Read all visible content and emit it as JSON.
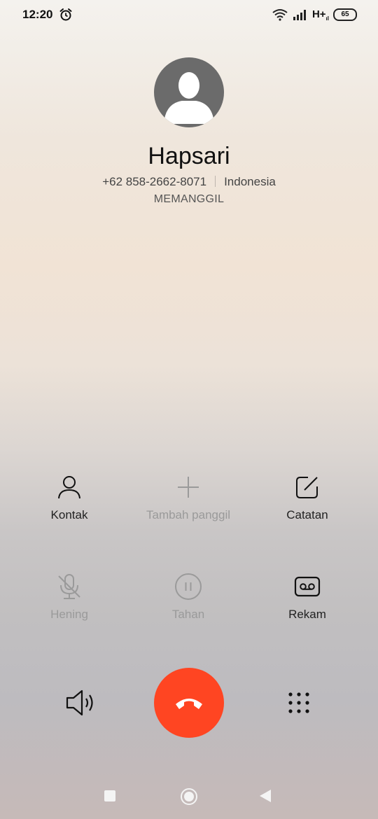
{
  "status_bar": {
    "time": "12:20",
    "network_type": "H+",
    "network_sub": "ıl",
    "battery": "65",
    "icons": [
      "alarm-icon",
      "wifi-icon",
      "signal-icon",
      "battery-icon"
    ]
  },
  "contact": {
    "name": "Hapsari",
    "number": "+62 858-2662-8071",
    "region": "Indonesia",
    "state": "MEMANGGIL"
  },
  "controls": {
    "contacts": "Kontak",
    "add_call": "Tambah panggil",
    "notes": "Catatan",
    "mute": "Hening",
    "hold": "Tahan",
    "record": "Rekam"
  },
  "colors": {
    "end_call": "#ff4522",
    "disabled": "#9a9a9a"
  }
}
